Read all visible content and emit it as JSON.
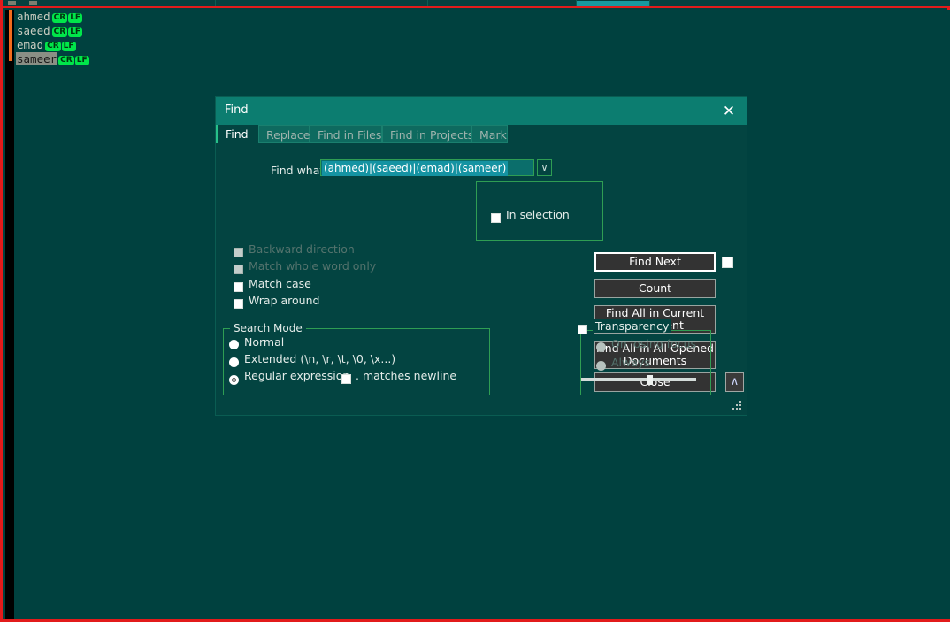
{
  "editor": {
    "lines": [
      {
        "text": "ahmed",
        "eol": [
          "CR",
          "LF"
        ],
        "selected": false
      },
      {
        "text": "saeed",
        "eol": [
          "CR",
          "LF"
        ],
        "selected": false
      },
      {
        "text": "emad",
        "eol": [
          "CR",
          "LF"
        ],
        "selected": false
      },
      {
        "text": "sameer",
        "eol": [
          "CR",
          "LF"
        ],
        "selected": true
      }
    ],
    "eol_cr": "CR",
    "eol_lf": "LF",
    "colors": {
      "background": "#00413f",
      "window_border": "#e21b1b",
      "eol_tag": "#00e64a",
      "change_marker": "#f36c1c",
      "selection": "#8a8f85"
    }
  },
  "dialog": {
    "title": "Find",
    "close_label": "✕",
    "tabs": [
      {
        "label": "Find",
        "active": true
      },
      {
        "label": "Replace",
        "active": false
      },
      {
        "label": "Find in Files",
        "active": false
      },
      {
        "label": "Find in Projects",
        "active": false
      },
      {
        "label": "Mark",
        "active": false
      }
    ],
    "find_what": {
      "label": "Find what:",
      "value": "(ahmed)|(saeed)|(emad)|(sameer)",
      "placeholder": "",
      "dropdown_glyph": "∨"
    },
    "in_selection": {
      "label": "In selection",
      "checked": false
    },
    "options": [
      {
        "label": "Backward direction",
        "checked": false,
        "disabled": true
      },
      {
        "label": "Match whole word only",
        "checked": false,
        "disabled": true
      },
      {
        "label": "Match case",
        "checked": false,
        "disabled": false
      },
      {
        "label": "Wrap around",
        "checked": false,
        "disabled": false
      }
    ],
    "buttons": [
      {
        "label": "Find Next",
        "focused": true
      },
      {
        "label": "Count",
        "focused": false
      },
      {
        "label": "Find All in Current Document",
        "focused": false
      },
      {
        "label": "Find All in All Opened Documents",
        "focused": false
      },
      {
        "label": "Close",
        "focused": false
      }
    ],
    "find_next_checkbox": {
      "checked": false
    },
    "search_mode": {
      "title": "Search Mode",
      "options": [
        {
          "label": "Normal",
          "selected": false
        },
        {
          "label": "Extended (\\n, \\r, \\t, \\0, \\x...)",
          "selected": false
        },
        {
          "label": "Regular expression",
          "selected": true
        }
      ],
      "dot_matches_newline": {
        "label": ". matches newline",
        "checked": false
      }
    },
    "transparency": {
      "title": "Transparency",
      "enabled": false,
      "options": [
        {
          "label": "On losing focus",
          "selected": false,
          "disabled": true
        },
        {
          "label": "Always",
          "selected": false,
          "disabled": true
        }
      ],
      "slider_percent": 60
    },
    "collapse_button": {
      "glyph": "∧"
    },
    "colors": {
      "titlebar": "#0c7d70",
      "body": "#034441",
      "group_border": "#2f9e53",
      "tab_inactive": "#0e6a5f",
      "accent": "#27c08a",
      "button_face": "#333333",
      "input_field": "#0b6e6b",
      "input_selection": "#1593a2"
    }
  }
}
